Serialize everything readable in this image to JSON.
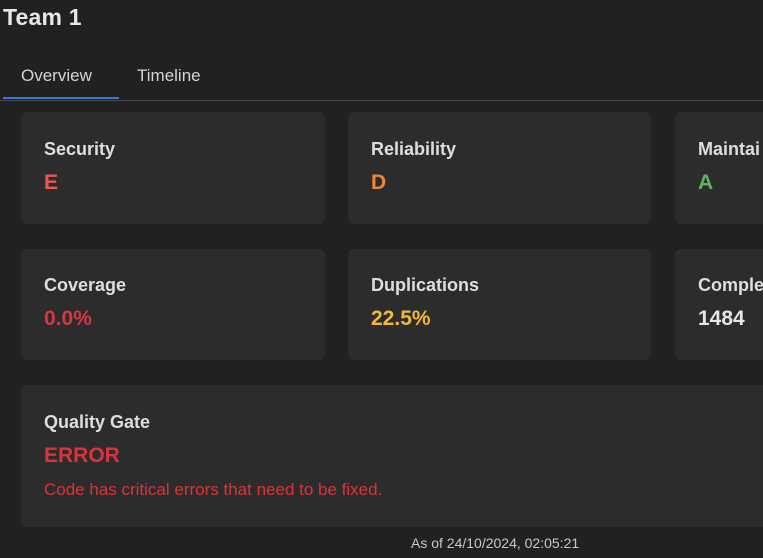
{
  "header": {
    "title": "Team 1"
  },
  "tabs": [
    {
      "label": "Overview",
      "active": true
    },
    {
      "label": "Timeline",
      "active": false
    }
  ],
  "metrics": {
    "security": {
      "label": "Security",
      "value": "E",
      "color": "#e8584f"
    },
    "reliability": {
      "label": "Reliability",
      "value": "D",
      "color": "#e9883a"
    },
    "maintainability": {
      "label": "Maintai",
      "value": "A",
      "color": "#5cb55c"
    },
    "coverage": {
      "label": "Coverage",
      "value": "0.0%",
      "color": "#d7373f"
    },
    "duplications": {
      "label": "Duplications",
      "value": "22.5%",
      "color": "#f0b93a"
    },
    "complexity": {
      "label": "Comple",
      "value": "1484",
      "color": "#e6e6e6"
    }
  },
  "quality_gate": {
    "label": "Quality Gate",
    "status": "ERROR",
    "message": "Code has critical errors that need to be fixed.",
    "color": "#d9343b"
  },
  "footer": {
    "timestamp": "As of 24/10/2024, 02:05:21"
  },
  "colors": {
    "background": "#212121",
    "card": "#2c2c2c",
    "tab_accent": "#2f7fd8"
  }
}
